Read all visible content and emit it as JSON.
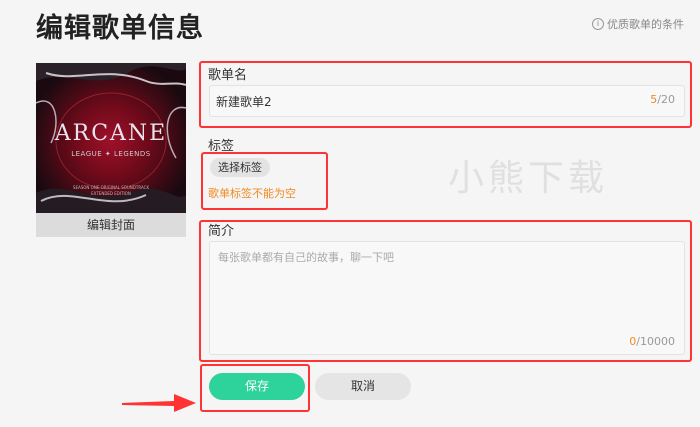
{
  "header": {
    "title": "编辑歌单信息",
    "hint": "优质歌单的条件",
    "hint_icon": "info-icon"
  },
  "cover": {
    "title": "ARCANE",
    "subtitle": "LEAGUE ✦ LEGENDS",
    "small_line1": "SEASON ONE ORIGINAL SOUNDTRACK",
    "small_line2": "EXTENDED EDITION",
    "edit_label": "编辑封面"
  },
  "form": {
    "name_label": "歌单名",
    "name_value": "新建歌单2",
    "name_count": "5",
    "name_max": "/20",
    "tag_label": "标签",
    "tag_button": "选择标签",
    "tag_error": "歌单标签不能为空",
    "intro_label": "简介",
    "intro_placeholder": "每张歌单都有自己的故事，聊一下吧",
    "intro_count": "0",
    "intro_max": "/10000"
  },
  "actions": {
    "save": "保存",
    "cancel": "取消"
  },
  "watermark": "小熊下载",
  "colors": {
    "accent": "#2ed29b",
    "warning": "#f08a24",
    "highlight": "#ff3333"
  }
}
